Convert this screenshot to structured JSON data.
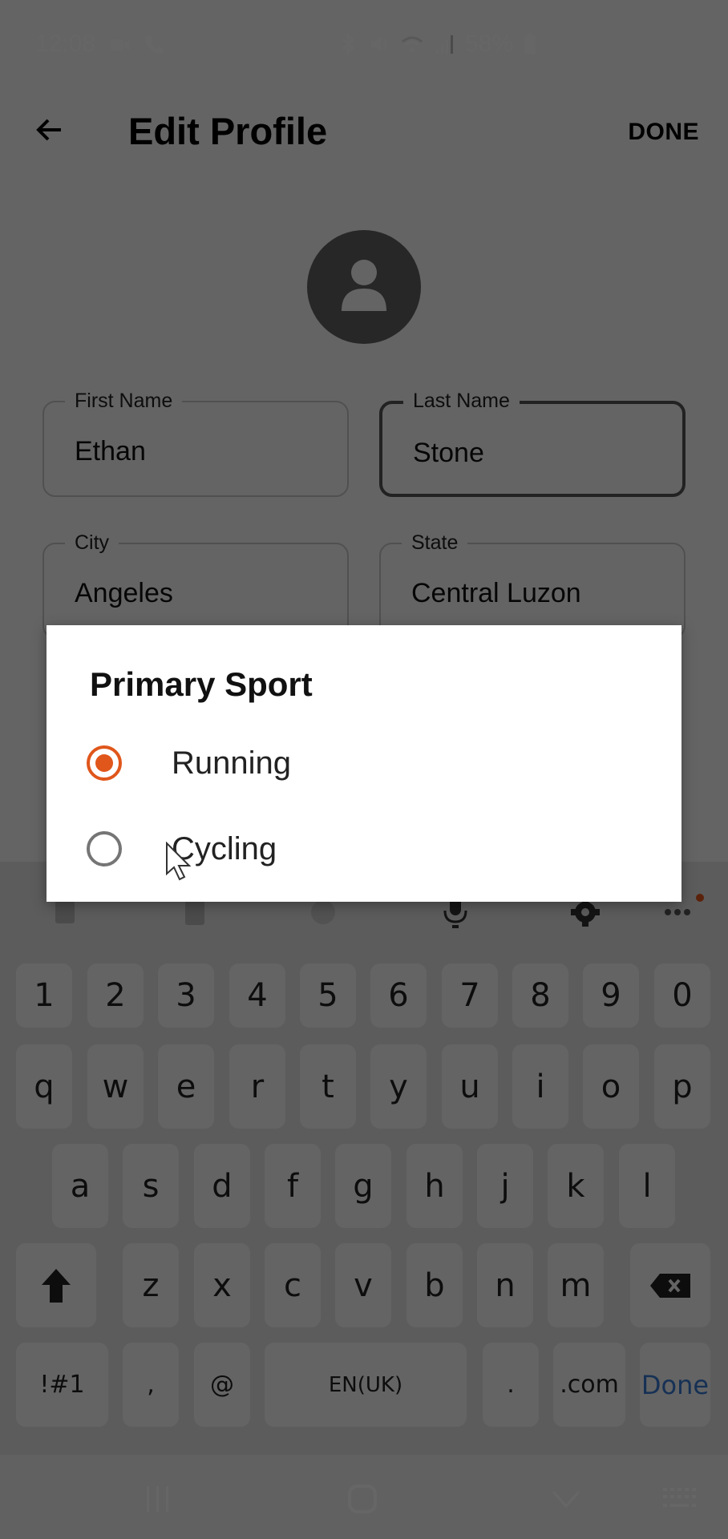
{
  "status_bar": {
    "time": "12:08",
    "left_icons": [
      "video-call-icon",
      "phone-icon"
    ],
    "right_icons": [
      "bluetooth-icon",
      "mute-vibrate-icon",
      "wifi-icon",
      "signal-icon"
    ],
    "battery": "58%"
  },
  "header": {
    "title": "Edit Profile",
    "back_icon": "arrow-left-icon",
    "done_label": "DONE"
  },
  "form": {
    "first_name": {
      "label": "First Name",
      "value": "Ethan"
    },
    "last_name": {
      "label": "Last Name",
      "value": "Stone"
    },
    "city": {
      "label": "City",
      "value": "Angeles"
    },
    "state": {
      "label": "State",
      "value": "Central Luzon"
    }
  },
  "dialog": {
    "title": "Primary Sport",
    "options": [
      {
        "label": "Running",
        "selected": true
      },
      {
        "label": "Cycling",
        "selected": false
      }
    ],
    "accent": "#e0561b"
  },
  "keyboard": {
    "toolbar": [
      "sticker-icon",
      "clipboard-icon",
      "emoji-icon",
      "microphone-icon",
      "settings-icon",
      "more-icon"
    ],
    "rows": [
      [
        "1",
        "2",
        "3",
        "4",
        "5",
        "6",
        "7",
        "8",
        "9",
        "0"
      ],
      [
        "q",
        "w",
        "e",
        "r",
        "t",
        "y",
        "u",
        "i",
        "o",
        "p"
      ],
      [
        "a",
        "s",
        "d",
        "f",
        "g",
        "h",
        "j",
        "k",
        "l"
      ],
      [
        "z",
        "x",
        "c",
        "v",
        "b",
        "n",
        "m"
      ]
    ],
    "bottom": {
      "symbols": "!#1",
      "comma": ",",
      "at": "@",
      "space": "EN(UK)",
      "period": ".",
      "dotcom": ".com",
      "done": "Done"
    }
  },
  "navbar": [
    "recents-icon",
    "home-icon",
    "hide-keyboard-icon",
    "keyboard-switch-icon"
  ]
}
